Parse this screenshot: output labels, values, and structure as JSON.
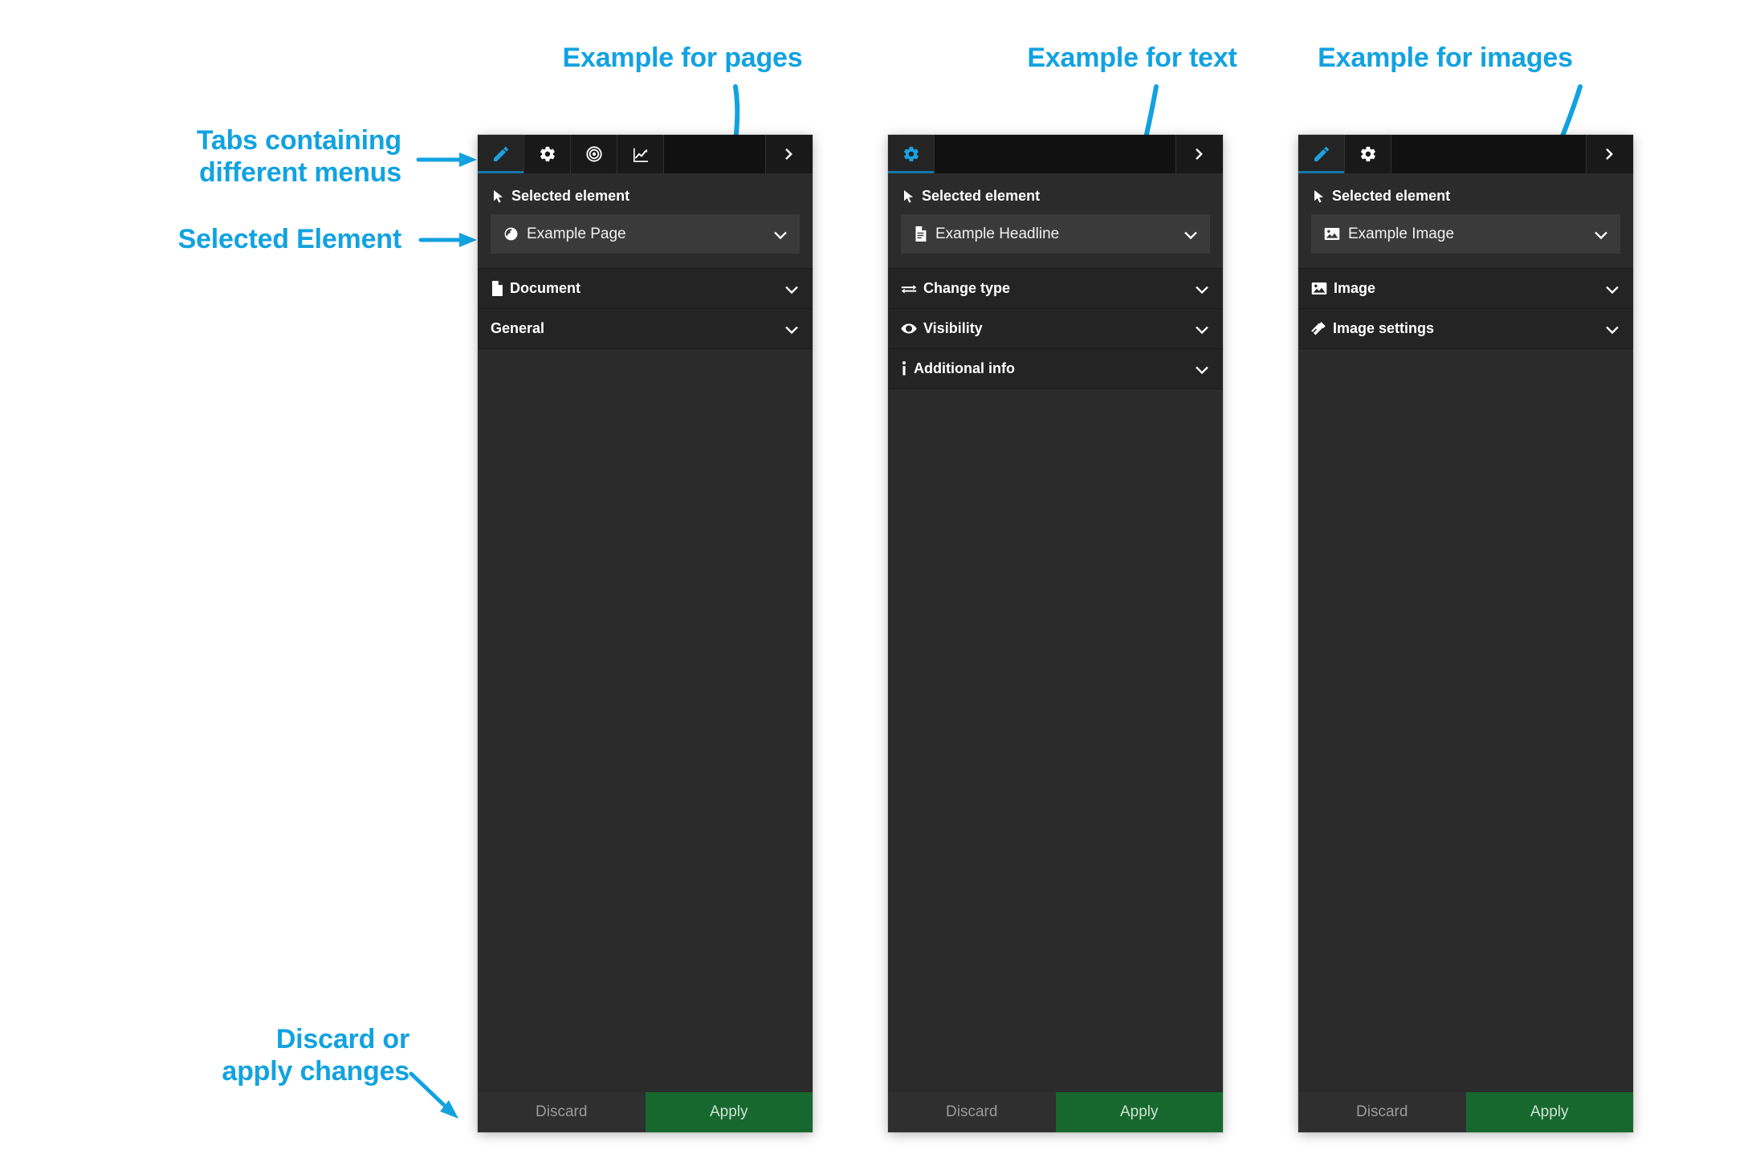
{
  "annotations": [
    {
      "id": "tabs",
      "text": "Tabs containing\ndifferent menus"
    },
    {
      "id": "selected_element",
      "text": "Selected Element"
    },
    {
      "id": "discard_apply",
      "text": "Discard or\napply changes"
    },
    {
      "id": "example_pages",
      "text": "Example for pages"
    },
    {
      "id": "example_text",
      "text": "Example for text"
    },
    {
      "id": "example_images",
      "text": "Example for images"
    }
  ],
  "colors": {
    "annotation_blue": "#12a2e0",
    "tab_active_blue": "#1ba1e2",
    "apply_green": "#17682e",
    "panel_background": "#2b2b2b",
    "tabbar_background": "#111111",
    "dropdown_background": "#3a3a3a"
  },
  "panels": [
    {
      "id": "pages",
      "tabs": [
        {
          "icon": "pencil-icon",
          "active": true
        },
        {
          "icon": "gear-icon",
          "active": false
        },
        {
          "icon": "target-icon",
          "active": false
        },
        {
          "icon": "chart-line-icon",
          "active": false
        }
      ],
      "collapse_icon": "chevron-right-icon",
      "selected": {
        "title": "Selected element",
        "title_icon": "cursor-arrow-icon",
        "value": "Example Page",
        "value_icon": "globe-icon",
        "caret_icon": "chevron-down-icon"
      },
      "sections": [
        {
          "label": "Document",
          "icon": "document-icon",
          "caret_icon": "chevron-down-icon"
        },
        {
          "label": "General",
          "icon": "none",
          "caret_icon": "chevron-down-icon"
        }
      ],
      "footer": {
        "discard": "Discard",
        "apply": "Apply"
      }
    },
    {
      "id": "text",
      "tabs": [
        {
          "icon": "gear-icon",
          "active": true
        }
      ],
      "collapse_icon": "chevron-right-icon",
      "selected": {
        "title": "Selected element",
        "title_icon": "cursor-arrow-icon",
        "value": "Example Headline",
        "value_icon": "text-document-icon",
        "caret_icon": "chevron-down-icon"
      },
      "sections": [
        {
          "label": "Change type",
          "icon": "swap-arrows-icon",
          "caret_icon": "chevron-down-icon"
        },
        {
          "label": "Visibility",
          "icon": "eye-icon",
          "caret_icon": "chevron-down-icon"
        },
        {
          "label": "Additional info",
          "icon": "info-icon",
          "caret_icon": "chevron-down-icon"
        }
      ],
      "footer": {
        "discard": "Discard",
        "apply": "Apply"
      }
    },
    {
      "id": "images",
      "tabs": [
        {
          "icon": "pencil-icon",
          "active": true
        },
        {
          "icon": "gear-icon",
          "active": false
        }
      ],
      "collapse_icon": "chevron-right-icon",
      "selected": {
        "title": "Selected element",
        "title_icon": "cursor-arrow-icon",
        "value": "Example Image",
        "value_icon": "image-icon",
        "caret_icon": "chevron-down-icon"
      },
      "sections": [
        {
          "label": "Image",
          "icon": "image-icon",
          "caret_icon": "chevron-down-icon"
        },
        {
          "label": "Image settings",
          "icon": "wand-icon",
          "caret_icon": "chevron-down-icon"
        }
      ],
      "footer": {
        "discard": "Discard",
        "apply": "Apply"
      }
    }
  ]
}
